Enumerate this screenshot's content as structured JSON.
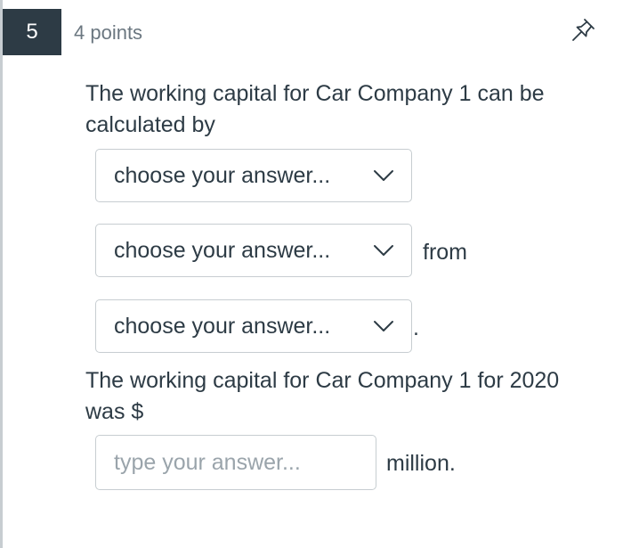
{
  "question": {
    "number": "5",
    "points": "4 points",
    "pin_icon": "pin-icon",
    "prompt_1": "The working capital for Car Company 1 can be calculated by",
    "dropdowns": [
      {
        "selected": "choose your answer..."
      },
      {
        "selected": "choose your answer..."
      },
      {
        "selected": "choose your answer..."
      }
    ],
    "text_from": "from",
    "text_period": ".",
    "prompt_2": "The working capital for Car Company 1 for 2020 was $",
    "answer_input": {
      "value": "",
      "placeholder": "type your answer..."
    },
    "text_units": "million."
  },
  "colors": {
    "number_badge_bg": "#2d3b45",
    "text": "#2d3b45",
    "muted_text": "#6b7780",
    "border": "#c7cdd1"
  }
}
